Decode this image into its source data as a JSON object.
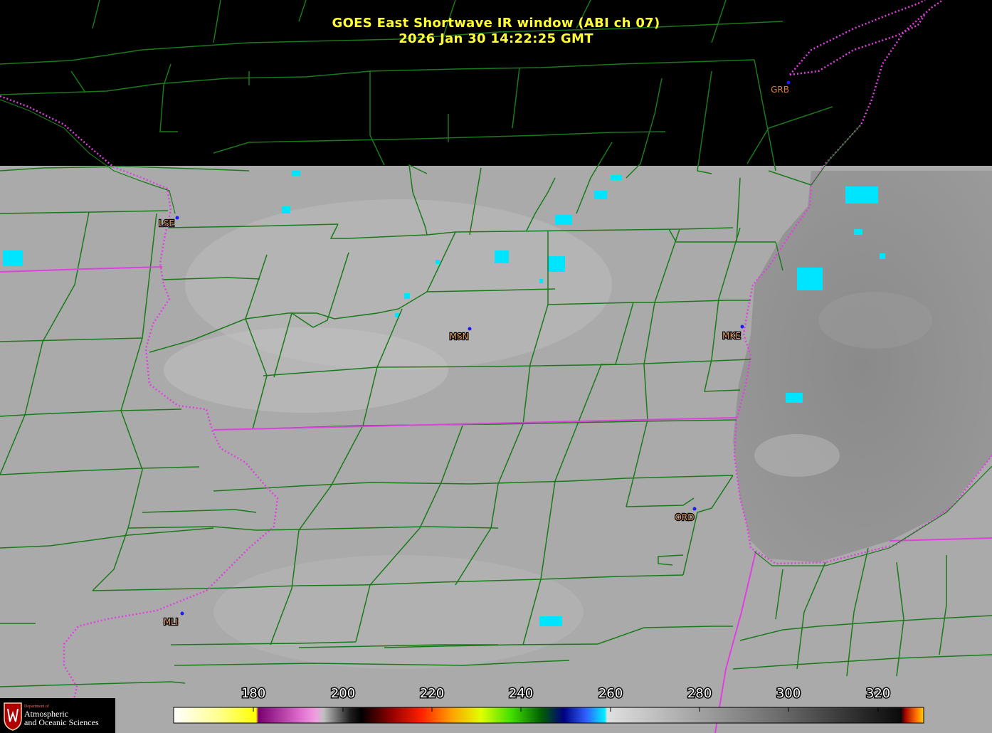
{
  "header": {
    "title": "GOES East Shortwave IR window (ABI ch 07)",
    "timestamp": "2026 Jan 30  14:22:25 GMT"
  },
  "cities": [
    {
      "code": "GRB",
      "label_color": "#e87a2a"
    },
    {
      "code": "LSE",
      "label_color": "#e8a060"
    },
    {
      "code": "MSN",
      "label_color": "#e8a060"
    },
    {
      "code": "MKE",
      "label_color": "#e8a060"
    },
    {
      "code": "ORD",
      "label_color": "#e8a060"
    },
    {
      "code": "MLI",
      "label_color": "#e8a060"
    }
  ],
  "colorbar": {
    "ticks": [
      "180",
      "200",
      "220",
      "240",
      "260",
      "280",
      "300",
      "320"
    ]
  },
  "logo": {
    "department": "Department of",
    "line1": "Atmospheric",
    "line2": "and Oceanic Sciences"
  },
  "colors": {
    "county_lines": "#1a7a1a",
    "state_lines": "#e040e0",
    "title": "#ffff33",
    "cold_cloud": "#00e5ff"
  }
}
